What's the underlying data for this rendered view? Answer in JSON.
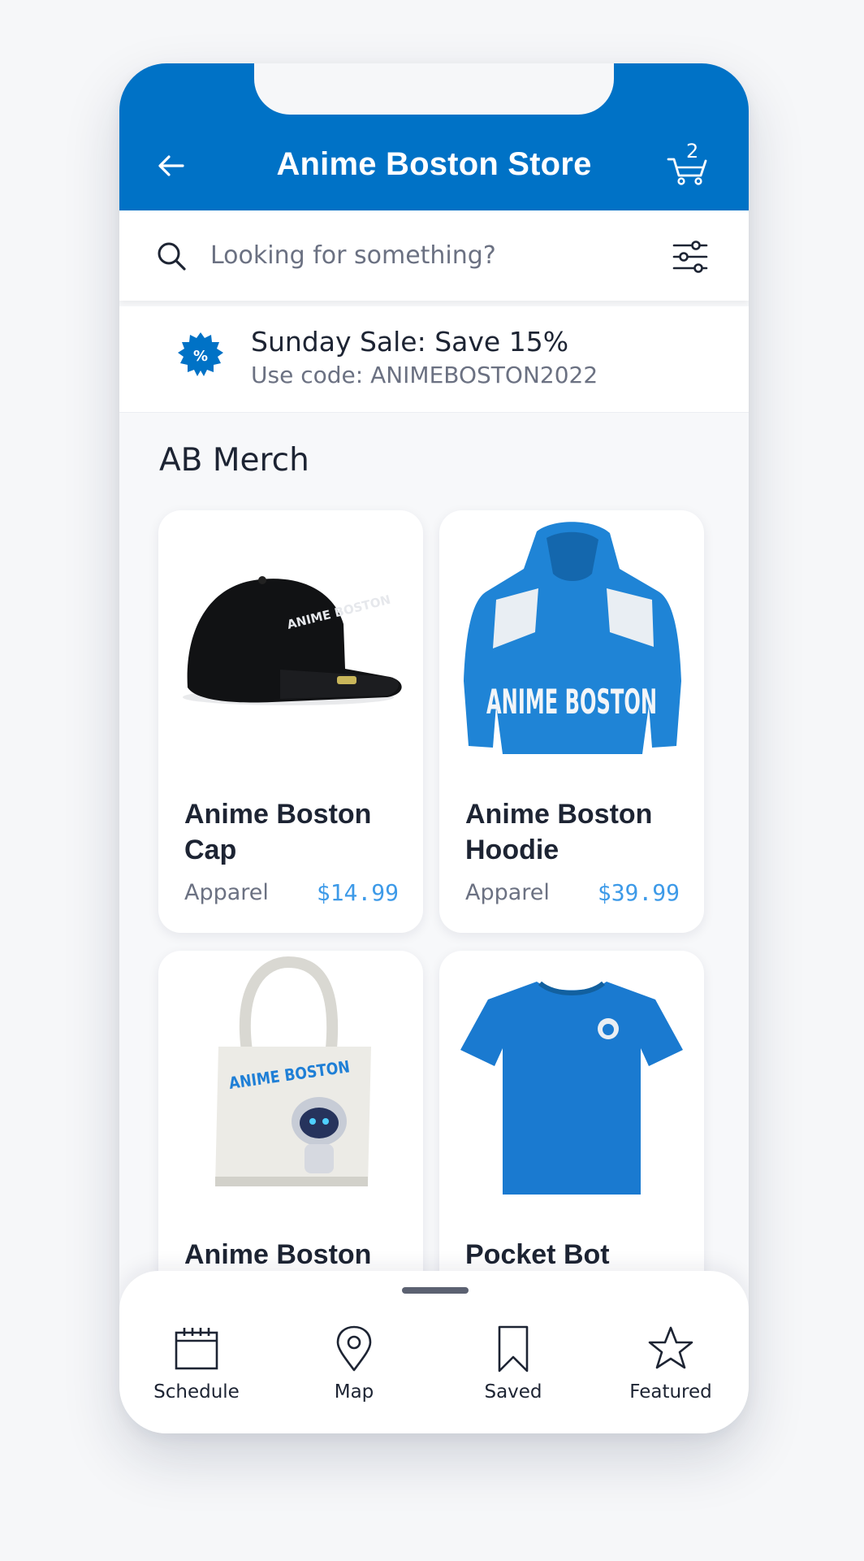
{
  "header": {
    "title": "Anime Boston Store",
    "cart_count": "2",
    "accent_color": "#0072c6"
  },
  "search": {
    "placeholder": "Looking for something?"
  },
  "promo": {
    "title": "Sunday Sale: Save 15%",
    "subtitle": "Use code: ANIMEBOSTON2022",
    "badge_symbol": "%"
  },
  "section": {
    "title": "AB Merch"
  },
  "products": [
    {
      "name": "Anime Boston Cap",
      "category": "Apparel",
      "price": "$14.99",
      "image": "black-cap"
    },
    {
      "name": "Anime Boston Hoodie",
      "category": "Apparel",
      "price": "$39.99",
      "image": "blue-hoodie"
    },
    {
      "name": "Anime Boston",
      "category": "",
      "price": "",
      "image": "tote-bag"
    },
    {
      "name": "Pocket Bot",
      "category": "",
      "price": "",
      "image": "blue-tshirt"
    }
  ],
  "product_images": {
    "cap_text": "ANIME BOSTON",
    "hoodie_text": "ANIME BOSTON",
    "tote_text": "ANIME BOSTON"
  },
  "bottom_nav": {
    "items": [
      {
        "label": "Schedule",
        "icon": "calendar-icon"
      },
      {
        "label": "Map",
        "icon": "map-pin-icon"
      },
      {
        "label": "Saved",
        "icon": "bookmark-icon"
      },
      {
        "label": "Featured",
        "icon": "star-icon"
      }
    ]
  }
}
